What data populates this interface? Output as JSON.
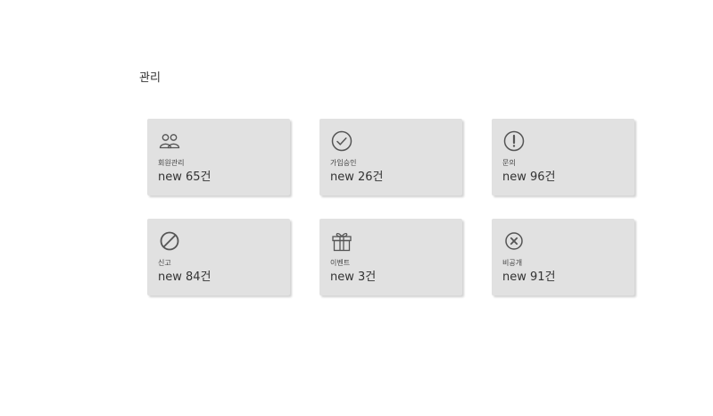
{
  "page": {
    "title": "관리"
  },
  "cards": [
    {
      "id": "members",
      "icon": "users-icon",
      "label": "회원관리",
      "count_text": "new 65건"
    },
    {
      "id": "approval",
      "icon": "check-circle-icon",
      "label": "가입승인",
      "count_text": "new 26건"
    },
    {
      "id": "inquiry",
      "icon": "exclamation-circle-icon",
      "label": "문의",
      "count_text": "new 96건"
    },
    {
      "id": "report",
      "icon": "ban-icon",
      "label": "신고",
      "count_text": "new 84건"
    },
    {
      "id": "event",
      "icon": "gift-icon",
      "label": "이벤트",
      "count_text": "new 3건"
    },
    {
      "id": "private",
      "icon": "x-circle-icon",
      "label": "비공개",
      "count_text": "new 91건"
    }
  ],
  "colors": {
    "card_background": "#e1e1e1",
    "icon": "#555555",
    "text": "#333333"
  }
}
